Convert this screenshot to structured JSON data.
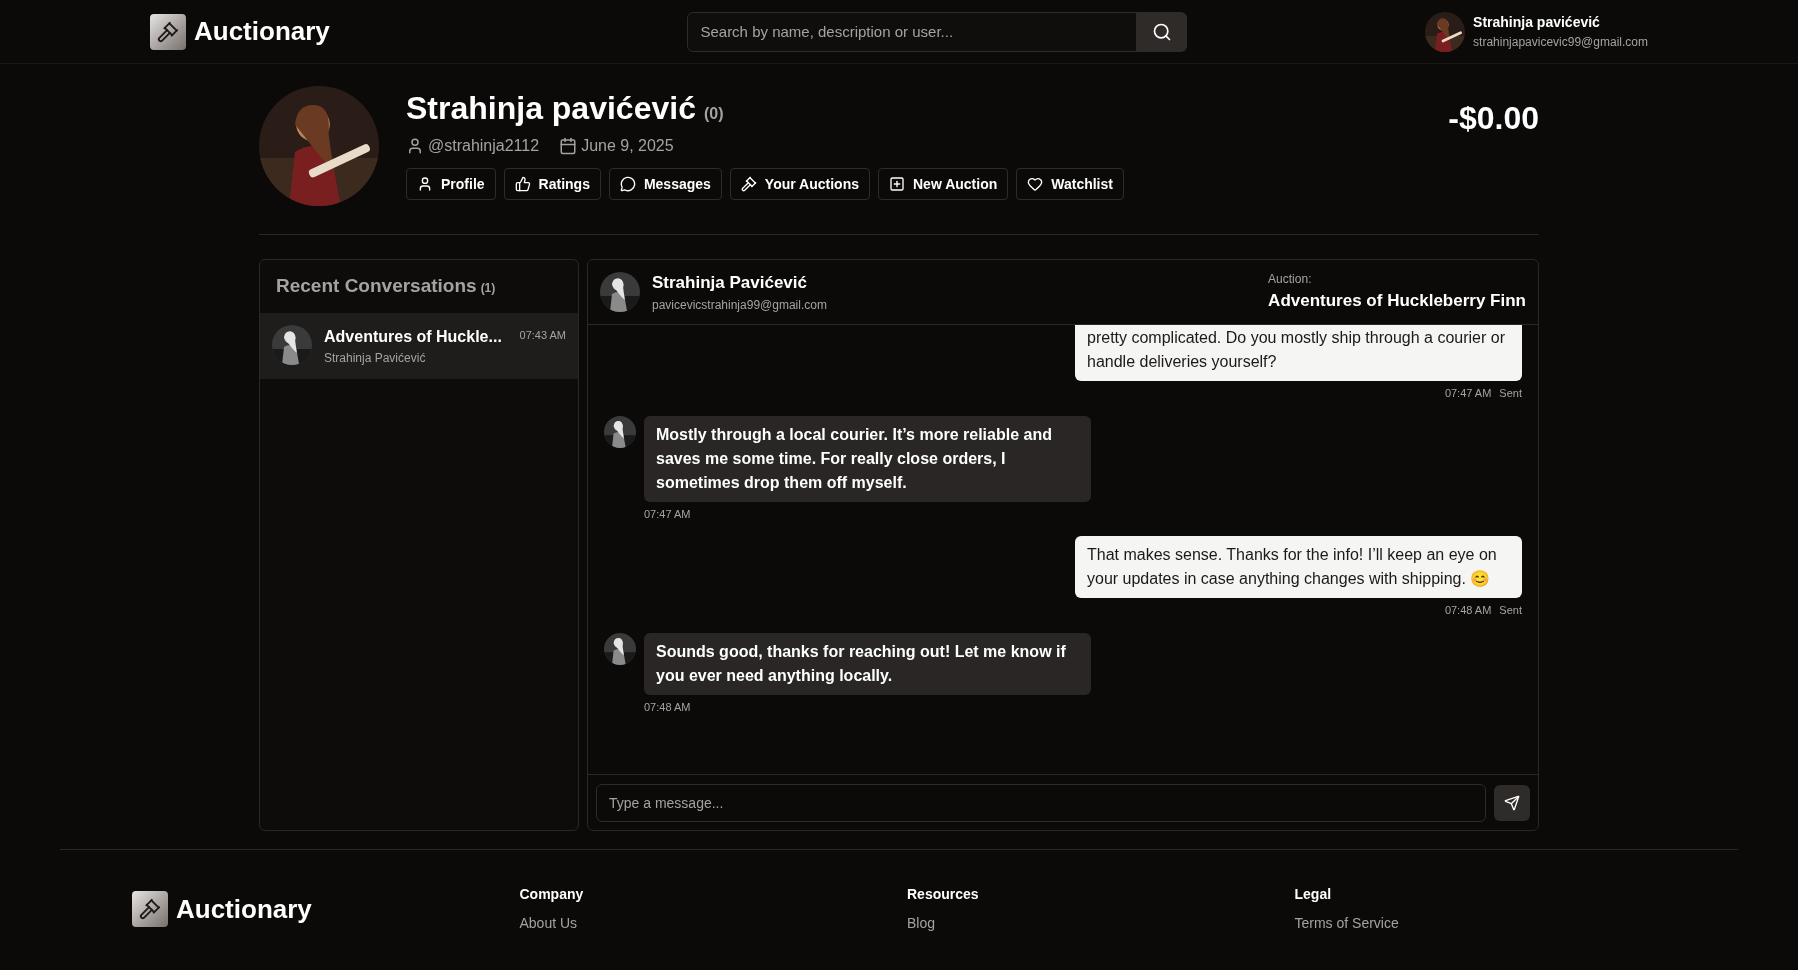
{
  "header": {
    "logo": "Auctionary",
    "search": {
      "placeholder": "Search by name, description or user..."
    },
    "user": {
      "name": "Strahinja pavićević",
      "email": "strahinjapavicevic99@gmail.com"
    }
  },
  "profile": {
    "name": "Strahinja pavićević",
    "rating_count": "(0)",
    "username": "@strahinja2112",
    "joined": "June 9, 2025",
    "balance": "-$0.00",
    "nav": [
      {
        "label": "Profile",
        "kind": "user",
        "selected": false
      },
      {
        "label": "Ratings",
        "kind": "thumb",
        "selected": false
      },
      {
        "label": "Messages",
        "kind": "chat",
        "selected": false
      },
      {
        "label": "Your Auctions",
        "kind": "gavel",
        "selected": false
      },
      {
        "label": "New Auction",
        "kind": "plus",
        "selected": false
      },
      {
        "label": "Watchlist",
        "kind": "heart",
        "selected": false
      }
    ]
  },
  "conversations": {
    "title": "Recent Conversations",
    "count": "(1)",
    "items": [
      {
        "title": "Adventures of Huckle...",
        "time": "07:43 AM",
        "user": "Strahinja Pavićević",
        "selected": true
      }
    ]
  },
  "chat": {
    "name": "Strahinja Pavićević",
    "email": "pavicevicstrahinja99@gmail.com",
    "auction_label": "Auction:",
    "auction_title": "Adventures of Huckleberry Finn",
    "messages": [
      {
        "kind": "sent",
        "text": "pretty complicated. Do you mostly ship through a courier or handle deliveries yourself?",
        "time": "07:47 AM",
        "status": "Sent",
        "cut": true
      },
      {
        "kind": "received",
        "text": "Mostly through a local courier. It’s more reliable and saves me some time. For really close orders, I sometimes drop them off myself.",
        "time": "07:47 AM"
      },
      {
        "kind": "sent",
        "text": "That makes sense. Thanks for the info! I’ll keep an eye on your updates in case anything changes with shipping. 😊",
        "time": "07:48 AM",
        "status": "Sent"
      },
      {
        "kind": "received",
        "text": "Sounds good, thanks for reaching out! Let me know if you ever need anything locally.",
        "time": "07:48 AM"
      }
    ],
    "input": {
      "placeholder": "Type a message..."
    }
  },
  "footer": {
    "logo": "Auctionary",
    "columns": [
      {
        "title": "Company",
        "links": [
          "About Us"
        ]
      },
      {
        "title": "Resources",
        "links": [
          "Blog"
        ]
      },
      {
        "title": "Legal",
        "links": [
          "Terms of Service"
        ]
      }
    ]
  }
}
